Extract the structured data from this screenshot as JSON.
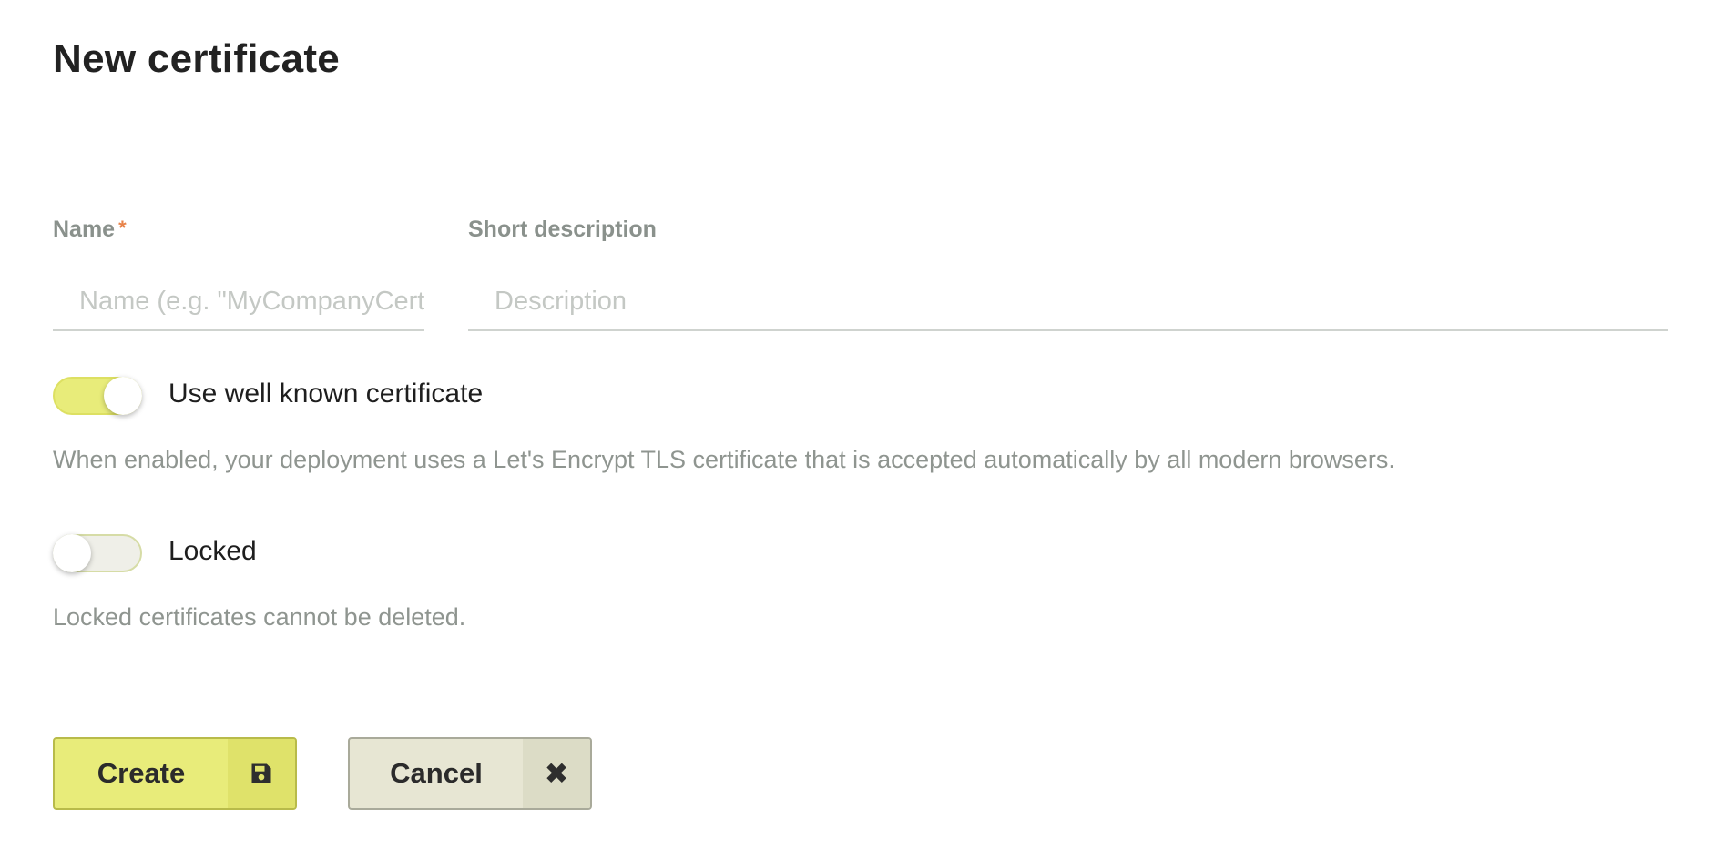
{
  "page": {
    "title": "New certificate"
  },
  "form": {
    "name": {
      "label": "Name",
      "required_mark": "*",
      "value": "",
      "placeholder": "Name (e.g. \"MyCompanyCert\")"
    },
    "description": {
      "label": "Short description",
      "value": "",
      "placeholder": "Description"
    }
  },
  "toggles": {
    "well_known": {
      "label": "Use well known certificate",
      "enabled": true,
      "help": "When enabled, your deployment uses a Let's Encrypt TLS certificate that is accepted automatically by all modern browsers."
    },
    "locked": {
      "label": "Locked",
      "enabled": false,
      "help": "Locked certificates cannot be deleted."
    }
  },
  "actions": {
    "create": {
      "label": "Create",
      "icon": "floppy-disk-icon"
    },
    "cancel": {
      "label": "Cancel",
      "icon": "close-icon"
    }
  },
  "colors": {
    "accent": "#e8ec7a",
    "required": "#e8834a",
    "muted_text": "#8f9590"
  }
}
